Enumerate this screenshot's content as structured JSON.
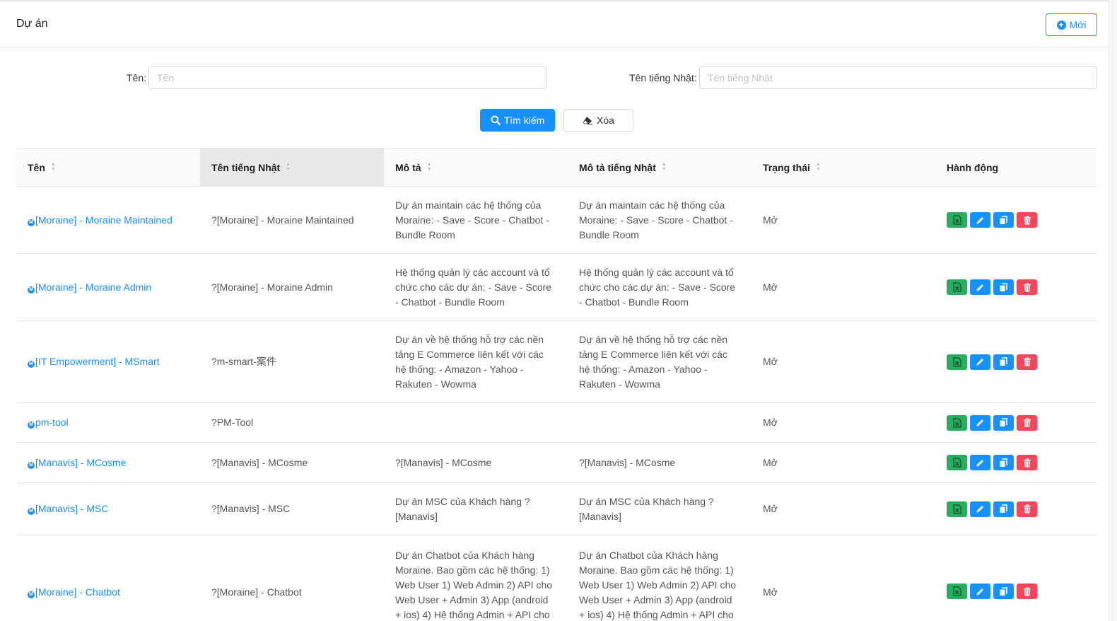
{
  "header": {
    "title": "Dự án",
    "new_button": "Mới"
  },
  "filters": {
    "name_label": "Tên:",
    "name_placeholder": "Tên",
    "name_value": "",
    "jp_name_label": "Tên tiếng Nhật:",
    "jp_name_placeholder": "Tên tiếng Nhật",
    "jp_name_value": "",
    "search_button": "Tìm kiếm",
    "clear_button": "Xóa"
  },
  "table": {
    "columns": [
      "Tên",
      "Tên tiếng Nhật",
      "Mô tả",
      "Mô tả tiếng Nhật",
      "Trạng thái",
      "Hành động"
    ],
    "sortable": [
      true,
      true,
      true,
      true,
      true,
      false
    ],
    "sorted_column": 1,
    "rows": [
      {
        "name": "[Moraine] - Moraine Maintained",
        "jp_name": "?[Moraine] - Moraine Maintained",
        "desc": "Dự án maintain các hệ thống của Moraine: - Save - Score - Chatbot - Bundle Room",
        "jp_desc": "Dự án maintain các hệ thống của Moraine: - Save - Score - Chatbot - Bundle Room",
        "status": "Mở"
      },
      {
        "name": "[Moraine] - Moraine Admin",
        "jp_name": "?[Moraine] - Moraine Admin",
        "desc": "Hệ thống quản lý các account và tổ chức cho các dự án: - Save - Score - Chatbot - Bundle Room",
        "jp_desc": "Hệ thống quản lý các account và tổ chức cho các dự án: - Save - Score - Chatbot - Bundle Room",
        "status": "Mở"
      },
      {
        "name": "[IT Empowerment] - MSmart",
        "jp_name": "?m-smart-案件",
        "desc": "Dự án về hệ thống hỗ trợ các nền tảng E Commerce liên kết với các hệ thống: - Amazon - Yahoo - Rakuten - Wowma",
        "jp_desc": "Dự án về hệ thống hỗ trợ các nền tảng E Commerce liên kết với các hệ thống: - Amazon - Yahoo - Rakuten - Wowma",
        "status": "Mở"
      },
      {
        "name": "pm-tool",
        "jp_name": "?PM-Tool",
        "desc": "",
        "jp_desc": "",
        "status": "Mở"
      },
      {
        "name": "[Manavis] - MCosme",
        "jp_name": "?[Manavis] - MCosme",
        "desc": "?[Manavis] - MCosme",
        "jp_desc": "?[Manavis] - MCosme",
        "status": "Mở"
      },
      {
        "name": "[Manavis] - MSC",
        "jp_name": "?[Manavis] - MSC",
        "desc": "Dự án MSC của Khách hàng ?[Manavis]",
        "jp_desc": "Dự án MSC của Khách hàng ?[Manavis]",
        "status": "Mở"
      },
      {
        "name": "[Moraine] - Chatbot",
        "jp_name": "?[Moraine] - Chatbot",
        "desc": "Dự án Chatbot của Khách hàng Moraine. Bao gồm các hệ thống: 1) Web User 1) Web Admin 2) API cho Web User + Admin 3) App (android + ios) 4) Hệ thống Admin + API cho",
        "jp_desc": "Dự án Chatbot của Khách hàng Moraine. Bao gồm các hệ thống: 1) Web User 1) Web Admin 2) API cho Web User + Admin 3) App (android + ios) 4) Hệ thống Admin + API cho",
        "status": "Mở"
      }
    ]
  },
  "colors": {
    "primary": "#1890ff",
    "export": "#27ae60",
    "delete": "#f5475b"
  },
  "icons": {
    "new": "plus-circle-icon",
    "search": "search-icon",
    "clear": "eraser-icon",
    "row_actions": [
      "excel-icon",
      "edit-icon",
      "copy-icon",
      "trash-icon"
    ]
  }
}
